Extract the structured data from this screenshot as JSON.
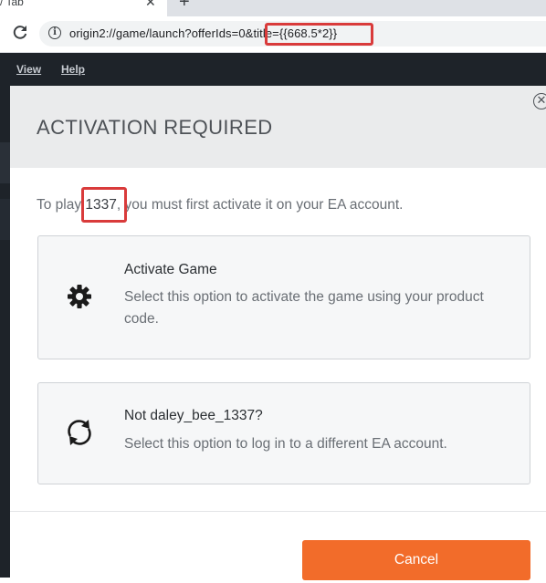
{
  "browser": {
    "tab_title": "/ Tab",
    "tab_close": "✕",
    "new_tab": "+",
    "url": "origin2://game/launch?offerIds=0&title={{668.5*2}}"
  },
  "app_menu": {
    "view": "View",
    "help": "Help"
  },
  "modal": {
    "title": "ACTIVATION REQUIRED",
    "close": "✕",
    "intro_prefix": "To play ",
    "game_name": "1337",
    "intro_suffix": ", you must first activate it on your EA account.",
    "options": [
      {
        "icon": "gear-icon",
        "title": "Activate Game",
        "description": "Select this option to activate the game using your product code."
      },
      {
        "icon": "sync-icon",
        "title": "Not daley_bee_1337?",
        "description": "Select this option to log in to a different EA account."
      }
    ],
    "cancel_label": "Cancel"
  },
  "colors": {
    "accent_orange": "#f26c2a",
    "highlight_red": "#d93b3b",
    "app_dark": "#1e2329"
  }
}
